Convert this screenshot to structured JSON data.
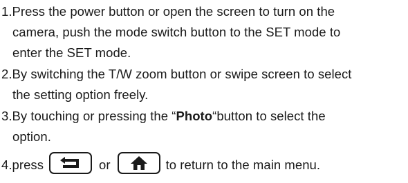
{
  "steps": [
    {
      "lines": [
        "1.Press the power button or open the screen to turn on the",
        "camera, push the mode switch button to the SET mode to",
        "enter the SET mode."
      ]
    },
    {
      "lines": [
        "2.By switching the T/W zoom button or swipe screen to select",
        "the setting option freely."
      ]
    },
    {
      "line1_prefix": "3.By touching or pressing the “",
      "line1_bold": "Photo",
      "line1_suffix": "“button to select the",
      "line2": "option."
    },
    {
      "prefix": "4.press",
      "or": "or",
      "suffix": "to return to the main menu.",
      "icons": [
        "back-icon",
        "home-icon"
      ]
    }
  ]
}
